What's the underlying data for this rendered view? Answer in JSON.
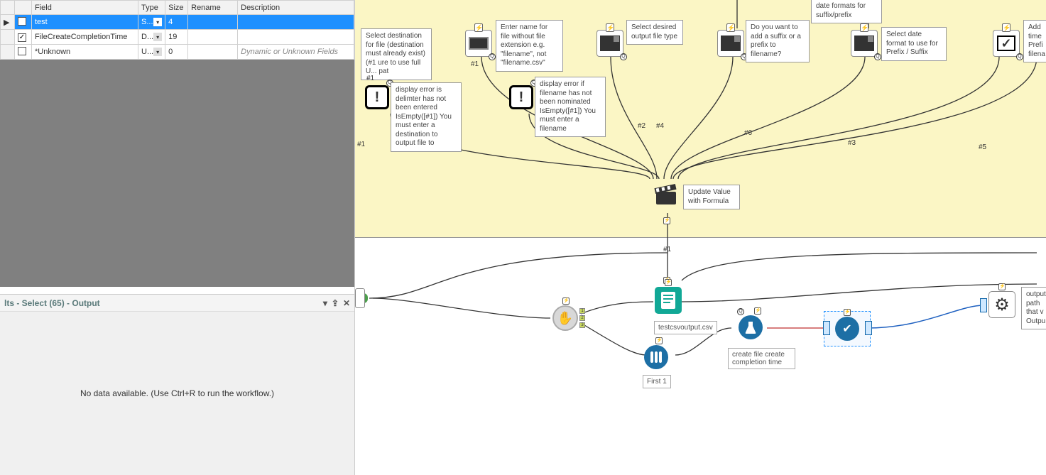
{
  "config_table": {
    "headers": [
      "",
      "",
      "Field",
      "Type",
      "Size",
      "Rename",
      "Description"
    ],
    "rows": [
      {
        "sel": true,
        "checked": false,
        "field": "test",
        "type": "S...",
        "size": "4",
        "rename": "",
        "desc": ""
      },
      {
        "sel": false,
        "checked": true,
        "field": "FileCreateCompletionTime",
        "type": "D...",
        "size": "19",
        "rename": "",
        "desc": ""
      },
      {
        "sel": false,
        "checked": false,
        "field": "*Unknown",
        "type": "U...",
        "size": "0",
        "rename": "",
        "desc": "Dynamic or Unknown Fields"
      }
    ]
  },
  "results": {
    "title": "lts - Select (65) - Output",
    "empty_msg": "No data available. (Use Ctrl+R to run the workflow.)"
  },
  "notes": {
    "n_dateformats_top": "date formats for suffix/prefix",
    "n_dest": "Select destination for file (destination must already exist) (#1 ure to use full U... pat",
    "n_delim": "display error is delimter has not been entered IsEmpty([#1]) You must enter a destination to output file to",
    "n_filename": "Enter name for file without file extension e.g. \"filename\", not \"filename.csv\"",
    "n_filename_err": "display error if filename has not been nominated IsEmpty([#1]) You must enter a filename",
    "n_filetype": "Select desired output file type",
    "n_suffix": "Do you want to add a suffix or a prefix to filename?",
    "n_dateformat": "Select date format to use for Prefix / Suffix",
    "n_addtime": "Add time Prefi filena",
    "n_updateval": "Update Value with Formula",
    "n_outputpath": "output path that v Outpu",
    "n_createfile": "create file create completion time",
    "n_csv": "testcsvoutput.csv",
    "n_first1": "First 1"
  },
  "wire_labels": {
    "l1": "#1",
    "l2": "#2",
    "l3": "#3",
    "l4": "#4",
    "l5": "#5",
    "l6": "#6",
    "l_macro_out": "#1",
    "l_left1": "#1"
  },
  "icons": {
    "text_input": "text-input-icon",
    "warning": "warning-icon",
    "dropdown": "dropdown-icon",
    "checkbox_big": "checkbox-icon",
    "clapper": "action-clapper-icon",
    "document": "document-tool-icon",
    "hand": "stop-hand-icon",
    "flask": "formula-flask-icon",
    "testtubes": "sample-testtubes-icon",
    "checkcircle": "check-circle-icon",
    "gear": "gear-icon"
  }
}
